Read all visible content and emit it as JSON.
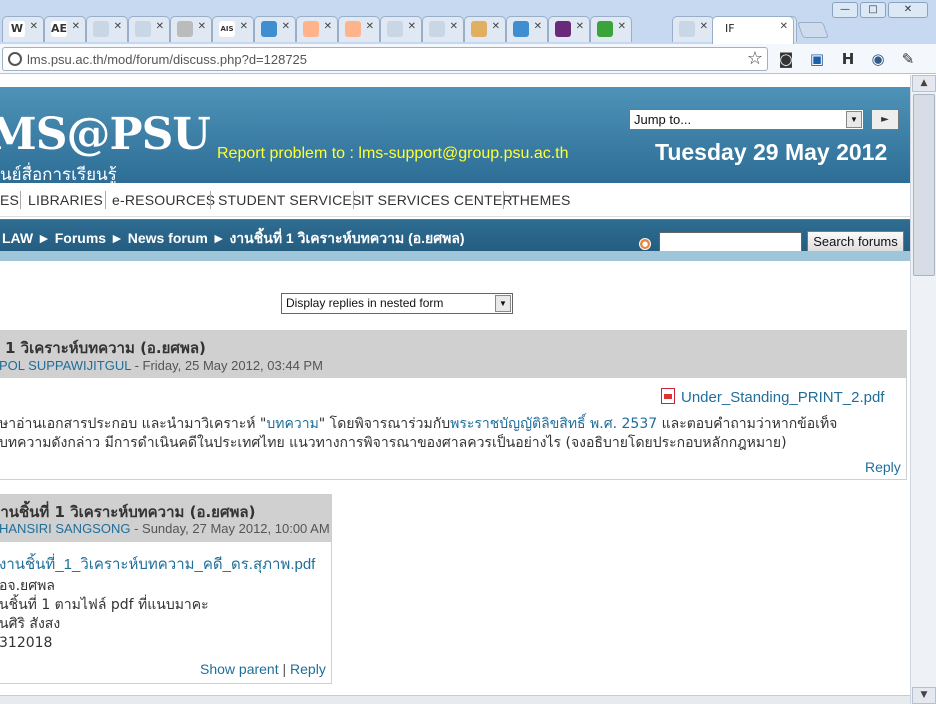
{
  "browser": {
    "tabs": [
      {
        "icon": "W",
        "color": "#ffffff"
      },
      {
        "icon": "AE",
        "color": "#ffffff"
      },
      {
        "icon": "",
        "color": "#c9d6e6"
      },
      {
        "icon": "",
        "color": "#c9d6e6"
      },
      {
        "icon": "",
        "color": "#bbbbbb"
      },
      {
        "icon": "AIS",
        "color": "#ffffff"
      },
      {
        "icon": "",
        "color": "#3f8fd0"
      },
      {
        "icon": "",
        "color": "#ffb38a"
      },
      {
        "icon": "",
        "color": "#ffb38a"
      },
      {
        "icon": "",
        "color": "#c9d6e6"
      },
      {
        "icon": "",
        "color": "#c9d6e6"
      },
      {
        "icon": "",
        "color": "#e0b060"
      },
      {
        "icon": "",
        "color": "#3f8fd0"
      },
      {
        "icon": "",
        "color": "#6a2a7a"
      },
      {
        "icon": "",
        "color": "#3aa33a"
      },
      {
        "icon": "",
        "color": "#c9d6e6"
      },
      {
        "icon": "",
        "color": "#c9d6e6"
      }
    ],
    "active_tab_label": "IF",
    "url": "lms.psu.ac.th/mod/forum/discuss.php?d=128725",
    "win_minimize": "—",
    "win_maximize": "□",
    "win_close": "✕",
    "toolbar_h": "H"
  },
  "site": {
    "logo": "MS@PSU",
    "logo_sub": "นย์สื่อการเรียนรู้",
    "report": "Report problem to : lms-support@group.psu.ac.th",
    "date": "Tuesday 29 May 2012",
    "jump_label": "Jump to...",
    "jump_go": "►"
  },
  "nav": [
    "ES",
    "LIBRARIES",
    "e-RESOURCES",
    "STUDENT SERVICES",
    "IT SERVICES CENTER",
    "THEMES"
  ],
  "breadcrumb": "LAW ► Forums ► News forum ► งานชิ้นที่ 1 วิเคราะห์บทความ (อ.ยศพล)",
  "search": {
    "button": "Search forums",
    "value": ""
  },
  "display_mode": "Display replies in nested form",
  "post1": {
    "title": "1 วิเคราะห์บทความ (อ.ยศพล)",
    "author": "POL SUPPAWIJITGUL",
    "date": " - Friday, 25 May 2012, 03:44 PM",
    "attachment": "Under_Standing_PRINT_2.pdf",
    "line1_a": "ษาอ่านเอกสารประกอบ และนำมาวิเคราะห์ \"",
    "line1_link1": "บทความ",
    "line1_b": "\" โดยพิจารณาร่วมกับ",
    "line1_link2": "พระราชบัญญัติลิขสิทธิ์ พ.ศ. 2537",
    "line1_c": " และตอบคำถามว่าหากข้อเท็จ",
    "line2": "บทความดังกล่าว มีการดำเนินคดีในประเทศไทย แนวทางการพิจารณาของศาลควรเป็นอย่างไร (จงอธิบายโดยประกอบหลักกฎหมาย)",
    "reply": "Reply"
  },
  "post2": {
    "title": "งานชิ้นที่ 1 วิเคราะห์บทความ (อ.ยศพล)",
    "author": "HANSIRI SANGSONG",
    "date": " - Sunday, 27 May 2012, 10:00 AM",
    "attachment": "งานชิ้นที่_1_วิเคราะห์บทความ_คดี_ดร.สุภาพ.pdf",
    "line1": "อจ.ยศพล",
    "line2": "นชิ้นที่ 1 ตามไฟล์ pdf ที่แนบมาคะ",
    "line3": "นศิริ สังสง",
    "line4": "312018",
    "show_parent": "Show parent",
    "separator": "|",
    "reply": "Reply"
  }
}
